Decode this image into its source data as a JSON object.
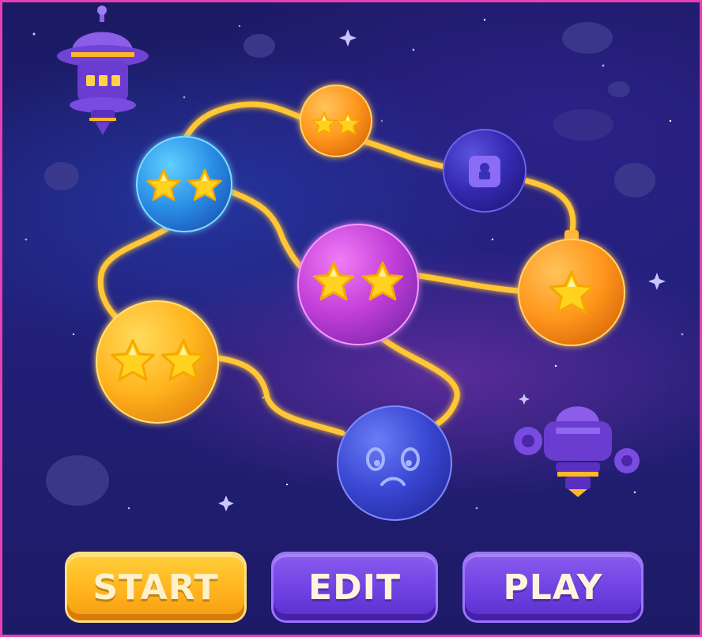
{
  "buttons": {
    "start_label": "START",
    "edit_label": "EDIT",
    "play_label": "PLAY"
  },
  "levels": [
    {
      "id": "level-orange-top",
      "color": "#ff9a1f",
      "state": "completed",
      "stars": 2
    },
    {
      "id": "level-blue",
      "color": "#2e9ff0",
      "state": "completed",
      "stars": 2
    },
    {
      "id": "level-locked",
      "color": "#3a2fb8",
      "state": "locked",
      "stars": 0
    },
    {
      "id": "level-magenta",
      "color": "#c13ed8",
      "state": "completed",
      "stars": 2
    },
    {
      "id": "level-orange-right",
      "color": "#ffa21e",
      "state": "completed",
      "stars": 1
    },
    {
      "id": "level-yellow",
      "color": "#ffb820",
      "state": "completed",
      "stars": 2
    },
    {
      "id": "level-sad-blue",
      "color": "#3b49d6",
      "state": "failed",
      "stars": 0
    }
  ],
  "icons": {
    "star": "star-icon",
    "lock": "lock-icon",
    "sad_face": "sad-face-icon",
    "spaceship": "spaceship-icon",
    "satellite": "satellite-icon"
  },
  "colors": {
    "background": "#1d1b66",
    "path": "#ffc634",
    "frame": "#e83fb4",
    "start_button": "#ffb21c",
    "secondary_button": "#6c3fe0"
  }
}
